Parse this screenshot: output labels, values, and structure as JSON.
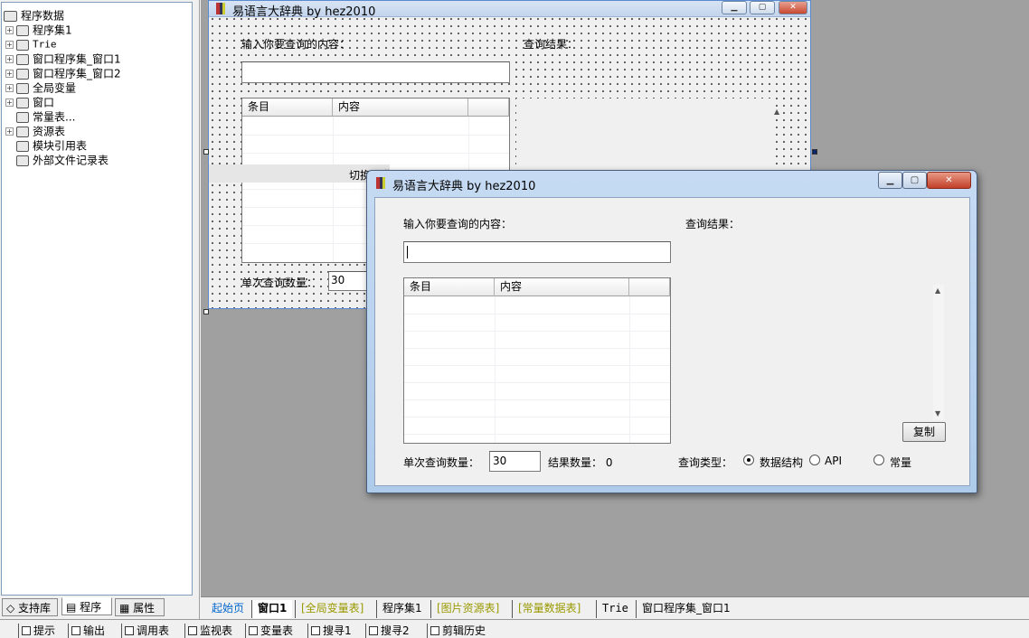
{
  "tree": {
    "root": "程序数据",
    "items": [
      {
        "label": "程序集1",
        "expander": "+",
        "icon": "stack-icon"
      },
      {
        "label": "Trie",
        "expander": "+",
        "icon": "class-icon"
      },
      {
        "label": "窗口程序集_窗口1",
        "expander": "+",
        "icon": "stack-icon"
      },
      {
        "label": "窗口程序集_窗口2",
        "expander": "+",
        "icon": "stack-icon"
      },
      {
        "label": "全局变量",
        "expander": "+",
        "icon": "variable-icon"
      },
      {
        "label": "窗口",
        "expander": "+",
        "icon": "window-icon"
      },
      {
        "label": "常量表...",
        "expander": "",
        "icon": "database-icon"
      },
      {
        "label": "资源表",
        "expander": "+",
        "icon": "resource-icon"
      },
      {
        "label": "模块引用表",
        "expander": "",
        "icon": "module-icon"
      },
      {
        "label": "外部文件记录表",
        "expander": "",
        "icon": "file-icon"
      }
    ]
  },
  "left_tabs": [
    "支持库",
    "程序",
    "属性"
  ],
  "design_window": {
    "title": "易语言大辞典 by hez2010",
    "query_label": "输入你要查询的内容：",
    "result_label": "查询结果：",
    "col_item": "条目",
    "col_content": "内容",
    "toggle_label": "切换词典",
    "count_label": "单次查询数量：",
    "count_value": "30"
  },
  "dialog": {
    "title": "易语言大辞典 by hez2010",
    "query_label": "输入你要查询的内容：",
    "result_label": "查询结果：",
    "col_item": "条目",
    "col_content": "内容",
    "count_label": "单次查询数量：",
    "count_value": "30",
    "result_count_label": "结果数量：",
    "result_count_value": "0",
    "copy_button": "复制",
    "type_label": "查询类型：",
    "options": [
      "数据结构",
      "API",
      "常量"
    ],
    "selected_option": "数据结构"
  },
  "bottom_tabs": [
    "起始页",
    "窗口1",
    "[全局变量表]",
    "程序集1",
    "[图片资源表]",
    "[常量数据表]",
    "Trie",
    "窗口程序集_窗口1"
  ],
  "active_bottom_tab": "窗口1",
  "status_tabs": [
    "提示",
    "输出",
    "调用表",
    "监视表",
    "变量表",
    "搜寻1",
    "搜寻2",
    "剪辑历史"
  ],
  "colors": {
    "titlebar": "#aecbea",
    "close_button": "#c2402a",
    "workspace": "#a0a0a0",
    "tab_link": "#0066cc",
    "tab_yellow": "#999900"
  }
}
